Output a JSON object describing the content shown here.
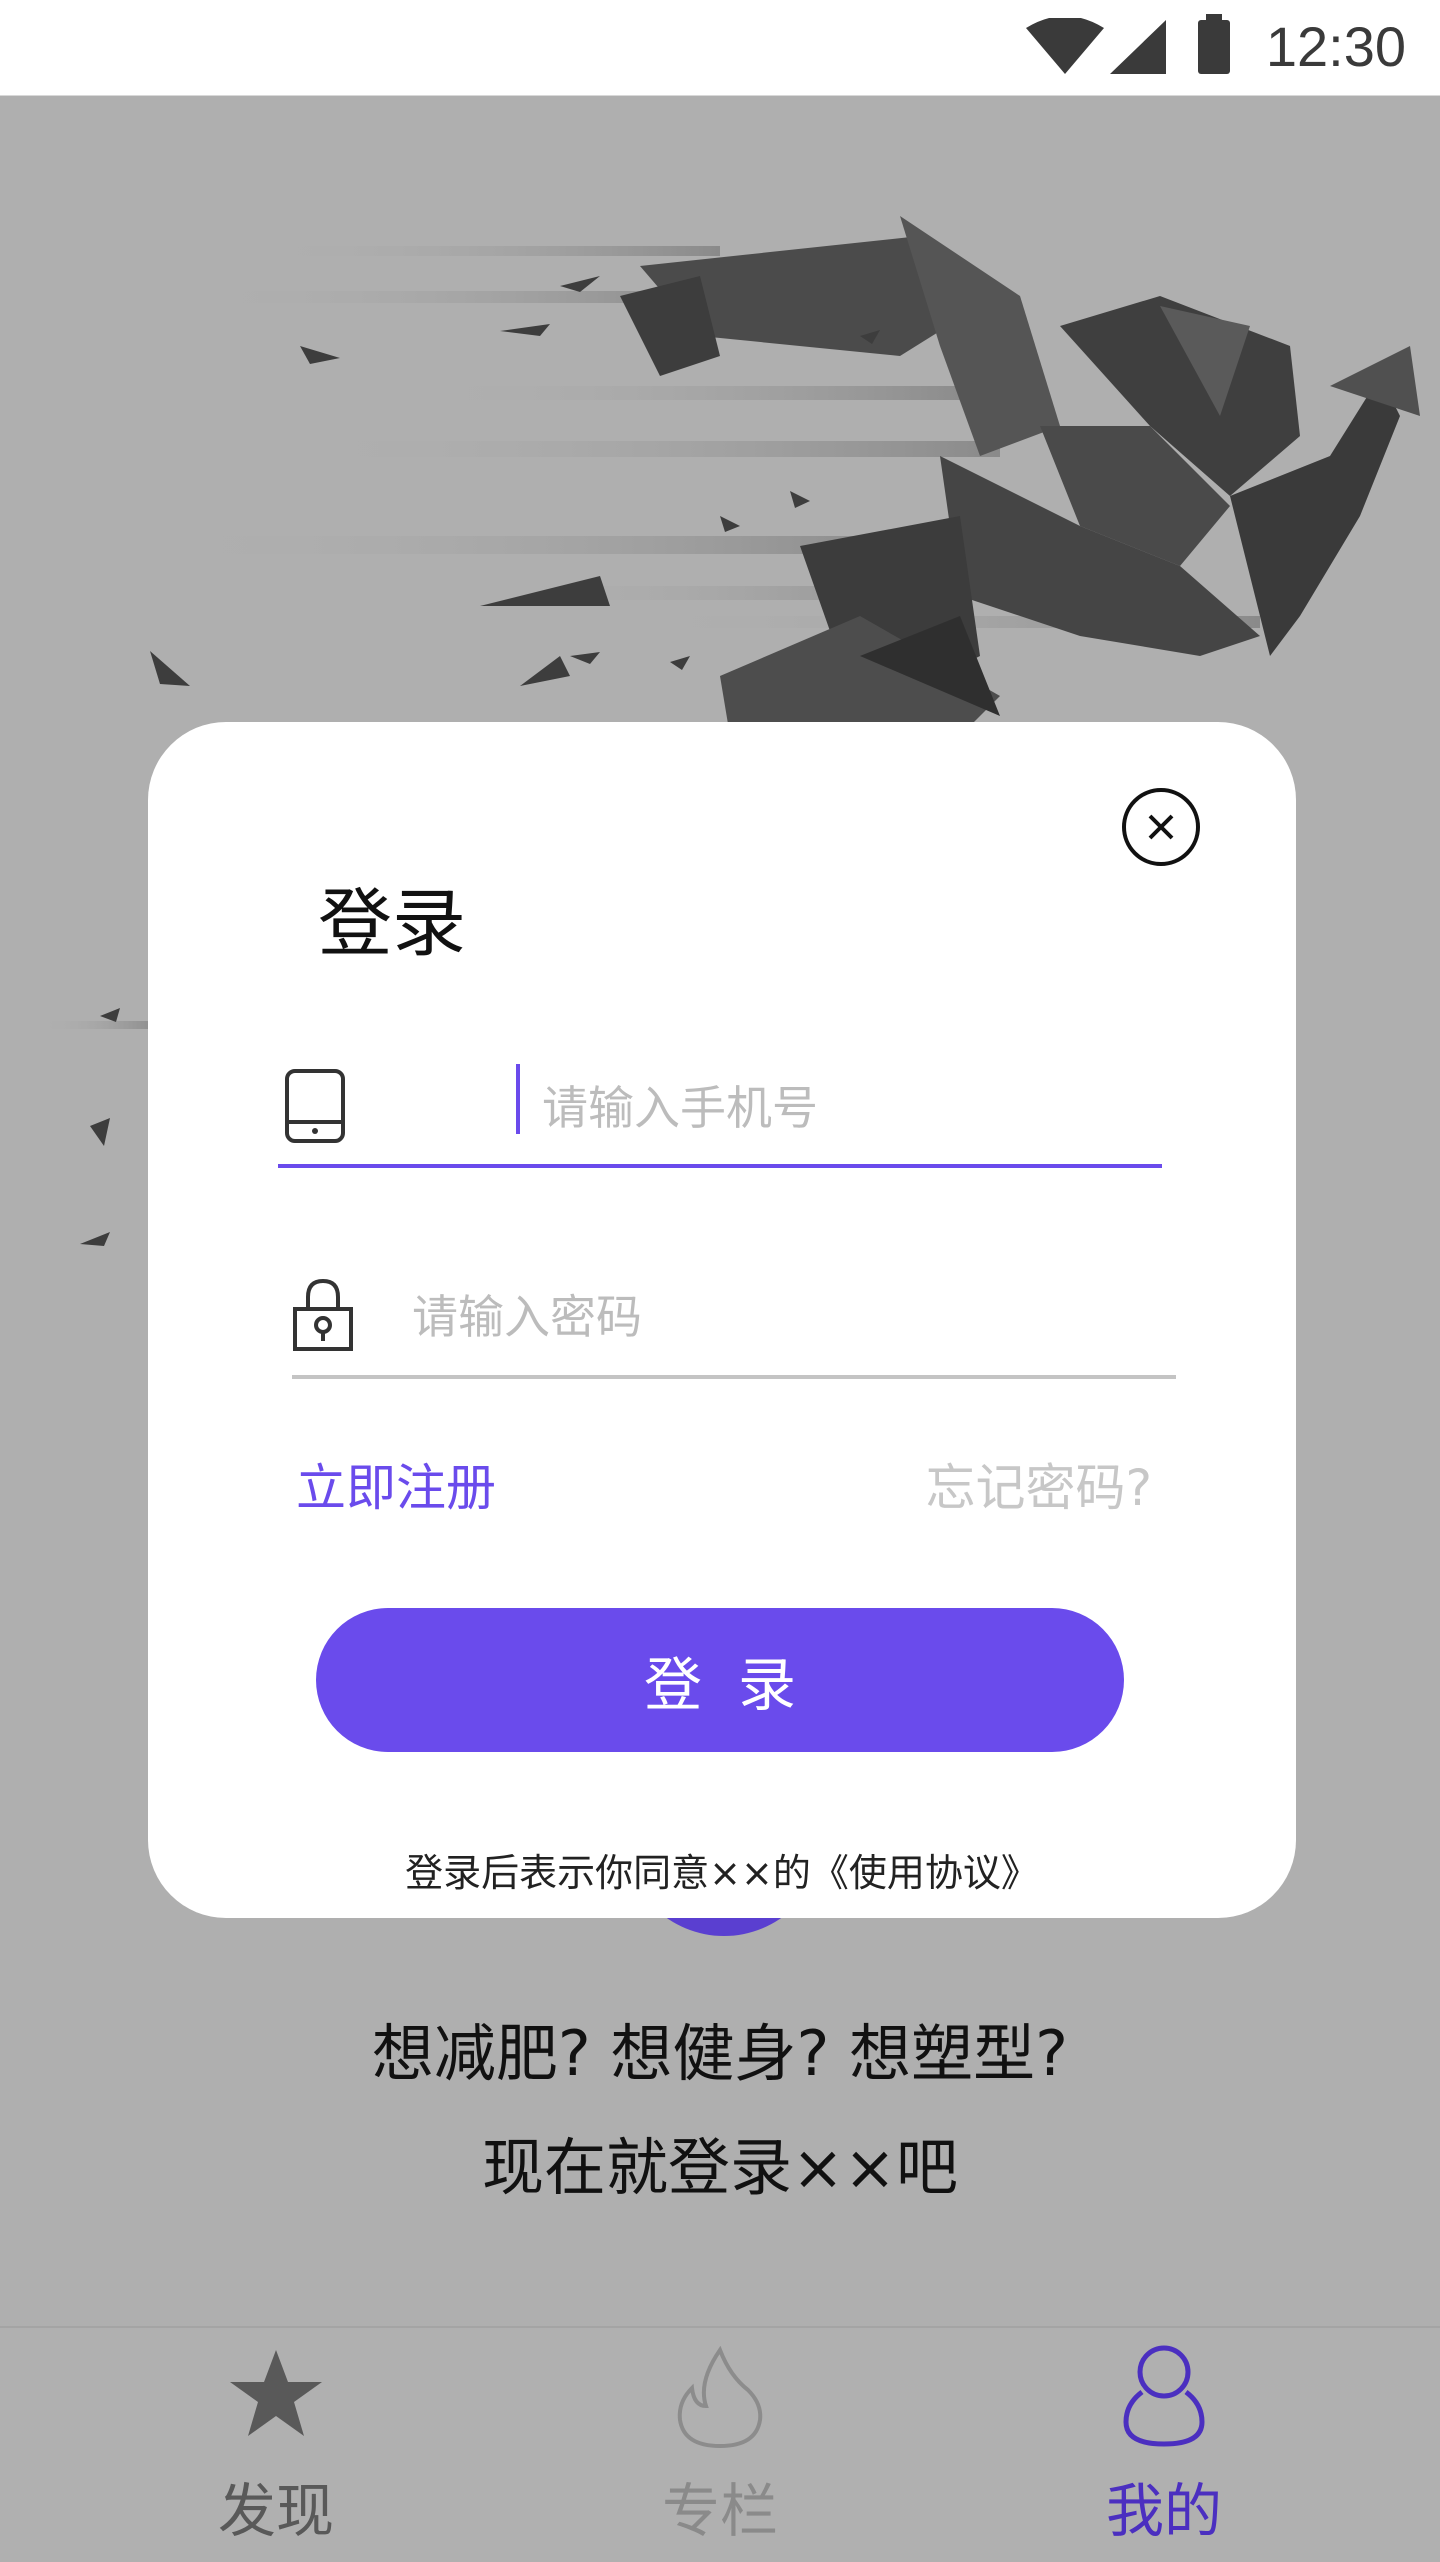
{
  "status_bar": {
    "time": "12:30",
    "icons": [
      "wifi-icon",
      "cell-signal-icon",
      "battery-icon"
    ]
  },
  "modal": {
    "title": "登录",
    "phone_placeholder": "请输入手机号",
    "password_placeholder": "请输入密码",
    "register_label": "立即注册",
    "forgot_label": "忘记密码?",
    "login_button_label": "登录",
    "agreement_text": "登录后表示你同意××的《使用协议》",
    "icons": [
      "close-icon",
      "phone-icon",
      "lock-icon"
    ]
  },
  "tagline": {
    "line1": "想减肥? 想健身? 想塑型?",
    "line2": "现在就登录××吧"
  },
  "tab_bar": {
    "items": [
      {
        "label": "发现",
        "icon": "star-icon",
        "active": false
      },
      {
        "label": "专栏",
        "icon": "flame-icon",
        "active": false
      },
      {
        "label": "我的",
        "icon": "person-icon",
        "active": true
      }
    ]
  },
  "colors": {
    "accent": "#6a4bec",
    "inactive": "#595959",
    "placeholder": "#bcbcbc",
    "background": "#afafaf"
  }
}
